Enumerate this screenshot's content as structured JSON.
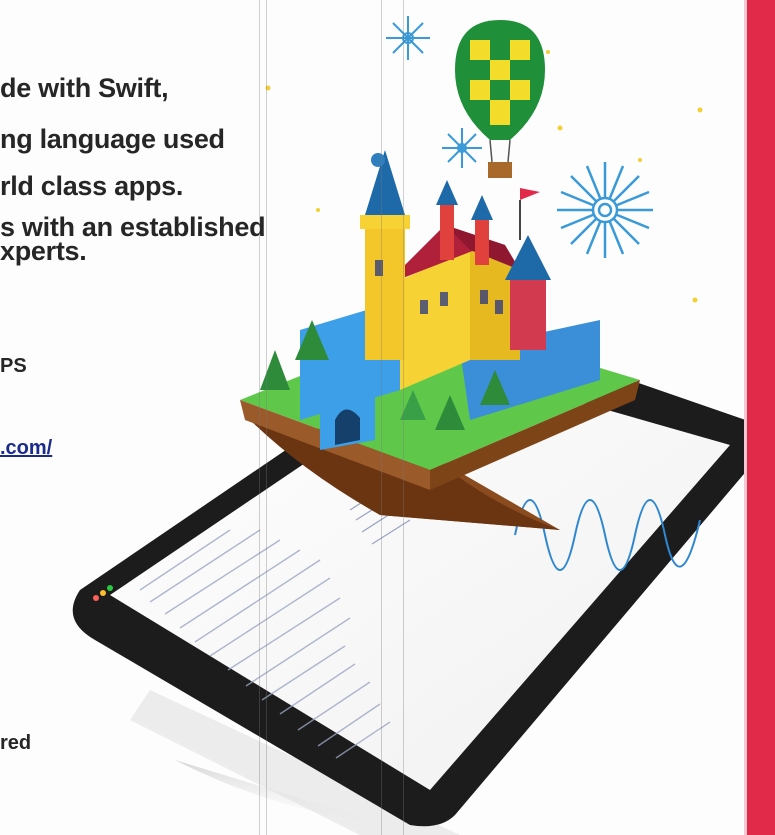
{
  "text": {
    "line1": "de with Swift,",
    "line2": "ng language used",
    "line3": "rld class apps.",
    "line4": "s with an established",
    "line5": "xperts.",
    "frag1": "PS",
    "link": ".com/",
    "frag2": "red"
  },
  "colors": {
    "accent_bar": "#e12a4a",
    "link": "#1a2c8a",
    "body_text": "#262626"
  },
  "icons": [
    "hot-air-balloon-icon",
    "firework-icon",
    "castle-illustration",
    "tablet-device",
    "sine-wave-icon"
  ]
}
